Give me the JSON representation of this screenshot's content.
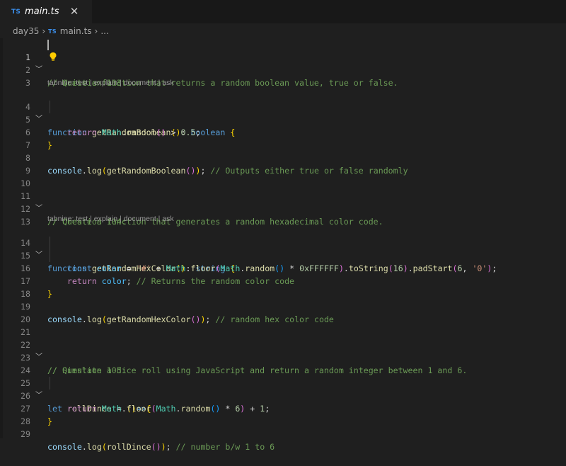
{
  "tab": {
    "lang_badge": "TS",
    "filename": "main.ts",
    "close": "✕"
  },
  "breadcrumbs": {
    "folder": "day35",
    "lang_badge": "TS",
    "file": "main.ts",
    "symbol": "..."
  },
  "codelens": [
    "tabnine:",
    "test",
    "explain",
    "document",
    "ask"
  ],
  "line_numbers": [
    "1",
    "2",
    "3",
    "4",
    "5",
    "6",
    "7",
    "8",
    "9",
    "10",
    "11",
    "12",
    "13",
    "14",
    "15",
    "16",
    "17",
    "18",
    "19",
    "20",
    "21",
    "22",
    "23",
    "24",
    "25",
    "26",
    "27",
    "28",
    "29"
  ],
  "code": {
    "l1": "// Question 103:",
    "l2": "Write a function that returns a random boolean value, true or false.",
    "l4_kw": "function",
    "l4_name": "getRandomBoolean",
    "l4_type": "boolean",
    "l5_ret": "return",
    "l5_obj": "Math",
    "l5_fn": "random",
    "l5_num": "0.5",
    "l8_obj": "console",
    "l8_fn": "log",
    "l8_call": "getRandomBoolean",
    "l8_cm": "// Outputs either true or false randomly",
    "l11": "// Question 104:",
    "l12": "// Create a function that generates a random hexadecimal color code.",
    "l14_kw": "function",
    "l14_name": "getRandomHexColor",
    "l14_type": "string",
    "l15_kw": "const",
    "l15_var": "color",
    "l15_str": "'#'",
    "l15_obj": "Math",
    "l15_fn1": "floor",
    "l15_fn2": "random",
    "l15_hex": "0xFFFFFF",
    "l15_fn3": "toString",
    "l15_n16": "16",
    "l15_fn4": "padStart",
    "l15_n6": "6",
    "l15_str0": "'0'",
    "l16_ret": "return",
    "l16_var": "color",
    "l16_cm": "// Returns the random color code",
    "l19_obj": "console",
    "l19_fn": "log",
    "l19_call": "getRandomHexColor",
    "l19_cm": "// random hex color code",
    "l22": "// Question 105:",
    "l23": "// Simulate a dice roll using JavaScript and return a random integer between 1 and 6.",
    "l25_kw": "let",
    "l25_name": "rollDince",
    "l26_ret": "return",
    "l26_obj": "Math",
    "l26_fn1": "floor",
    "l26_fn2": "random",
    "l26_n6": "6",
    "l26_n1": "1",
    "l29_obj": "console",
    "l29_fn": "log",
    "l29_call": "rollDince",
    "l29_cm": "// number b/w 1 to 6"
  },
  "colors": {
    "editor_bg": "#1f1f1f",
    "comment": "#6a9955",
    "keyword": "#569cd6",
    "control": "#c586c0",
    "function": "#dcdcaa",
    "type": "#4ec9b0",
    "number": "#b5cea8",
    "string": "#ce9178",
    "ts_badge": "#3b8eea"
  }
}
